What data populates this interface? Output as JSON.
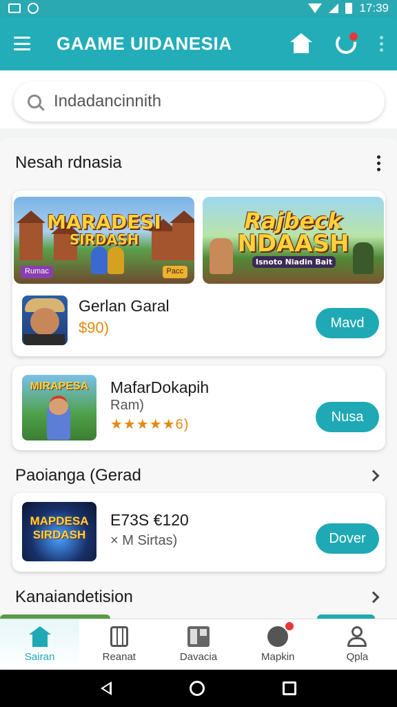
{
  "status_bar": {
    "time": "17:39"
  },
  "app_bar": {
    "title": "GAAME UIDANESIA"
  },
  "search": {
    "value": "Indadancinnith"
  },
  "section_featured": {
    "title": "Nesah rdnasia",
    "banners": [
      {
        "title_line1": "MARADESI",
        "title_line2": "SIRDASH",
        "chip_left": "Rumac",
        "chip_right": "Pacc"
      },
      {
        "title_line1": "Rajbeck",
        "title_line2": "NDAASH",
        "caption": "Isnoto Niadin Bait"
      }
    ],
    "item": {
      "name": "Gerlan Garal",
      "price": "$90)",
      "button": "Mavd"
    }
  },
  "card_game": {
    "name": "MafarDokapih",
    "sub": "Ram)",
    "rating": "★★★★★6)",
    "button": "Nusa",
    "thumb_title": "MIRAPESA"
  },
  "section_second": {
    "title": "Paoianga  (Gerad",
    "item": {
      "name": "E73S €120",
      "sub": "× M Sirtas)",
      "button": "Dover",
      "thumb_title": "MAPDESA SIRDASH"
    }
  },
  "section_third": {
    "title": "Kanaiandetision"
  },
  "bottom_nav": [
    {
      "label": "Sairan",
      "icon": "home-icon"
    },
    {
      "label": "Reanat",
      "icon": "store-icon"
    },
    {
      "label": "Davacia",
      "icon": "grid-icon"
    },
    {
      "label": "Mapkin",
      "icon": "chat-icon"
    },
    {
      "label": "Qpla",
      "icon": "user-icon"
    }
  ],
  "colors": {
    "primary": "#23adb8",
    "accent_button": "#1fa9b4",
    "price": "#e08a10",
    "badge": "#e53935"
  }
}
